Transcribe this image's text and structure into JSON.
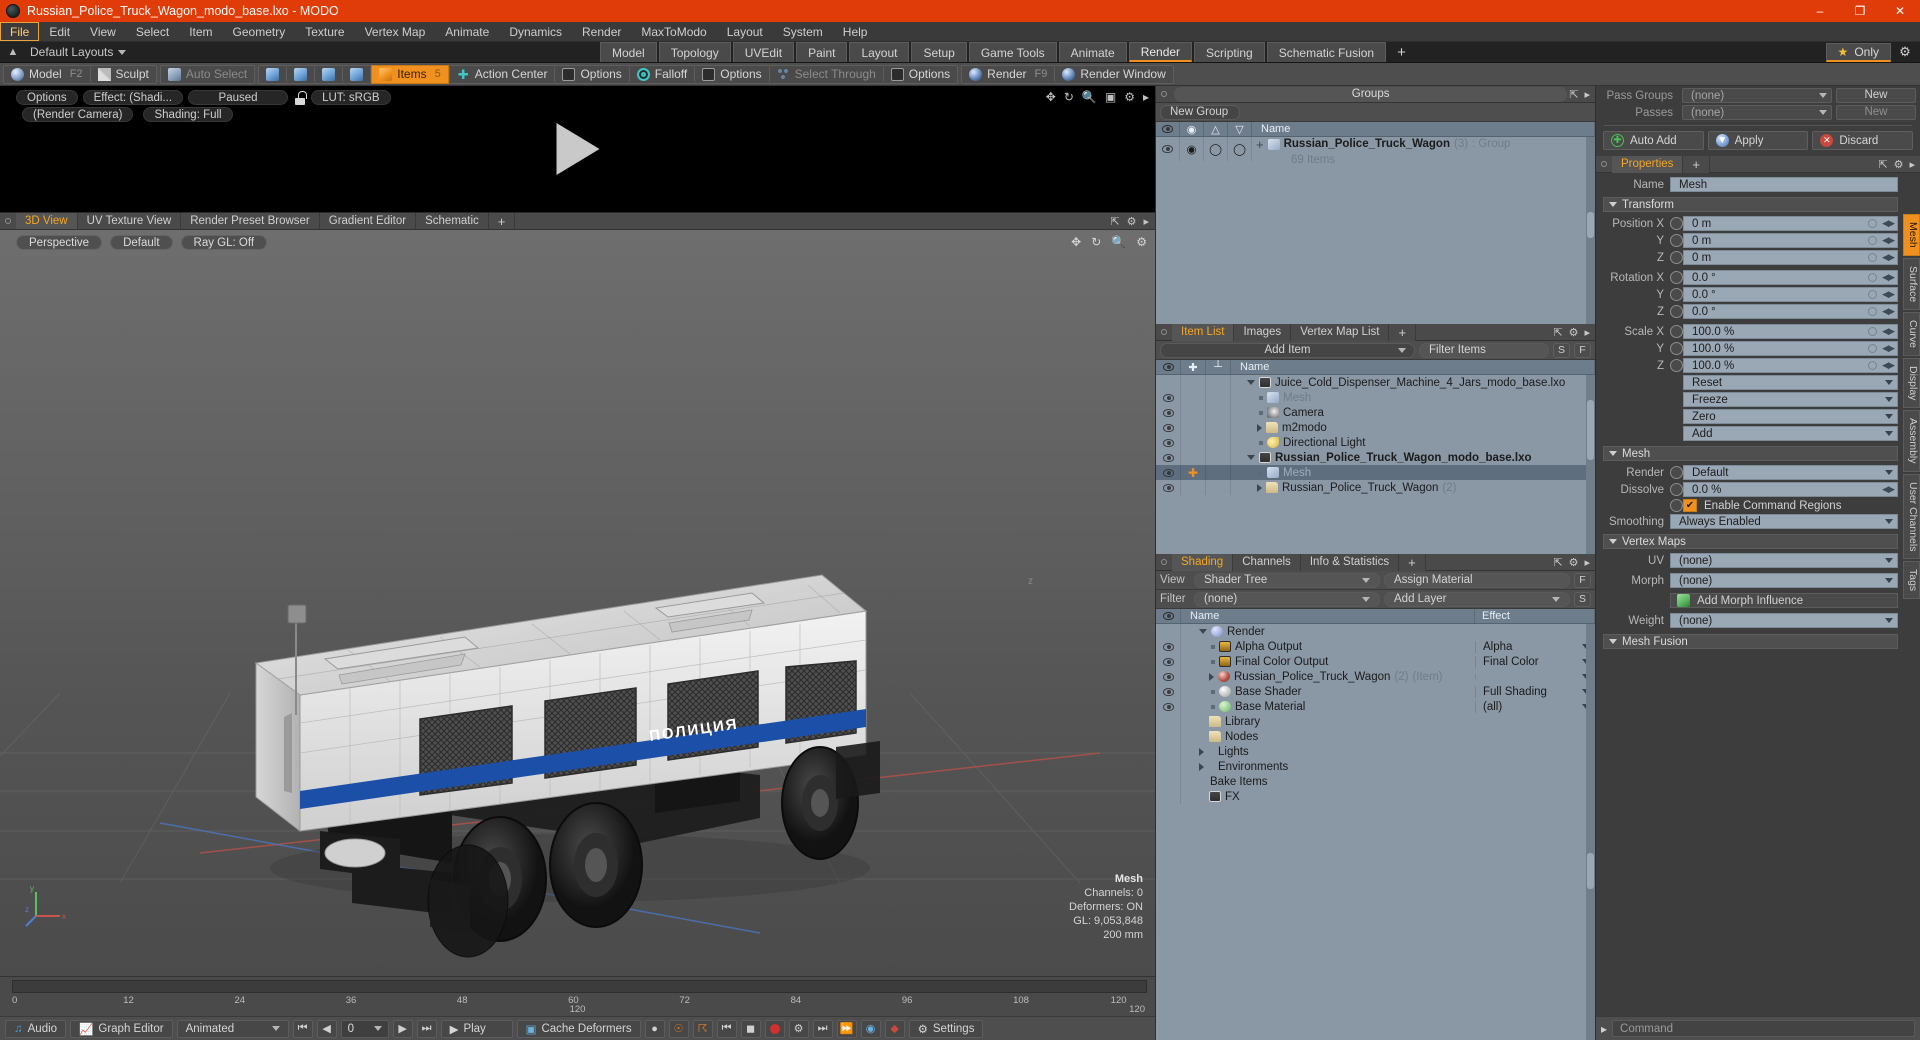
{
  "window": {
    "title": "Russian_Police_Truck_Wagon_modo_base.lxo - MODO",
    "minimize": "–",
    "maximize": "❐",
    "close": "✕"
  },
  "menu": {
    "items": [
      "File",
      "Edit",
      "View",
      "Select",
      "Item",
      "Geometry",
      "Texture",
      "Vertex Map",
      "Animate",
      "Dynamics",
      "Render",
      "MaxToModo",
      "Layout",
      "System",
      "Help"
    ],
    "active": "File"
  },
  "layoutbar": {
    "default_layouts": "Default Layouts",
    "tabs": [
      "Model",
      "Topology",
      "UVEdit",
      "Paint",
      "Layout",
      "Setup",
      "Game Tools",
      "Animate",
      "Render",
      "Scripting",
      "Schematic Fusion"
    ],
    "active_tab": "Render",
    "add_tab": "+",
    "only_label": "Only",
    "star_icon": "★",
    "gear_icon": "⚙"
  },
  "modebar": {
    "model": "Model",
    "model_hint": "F2",
    "sculpt": "Sculpt",
    "auto_select": "Auto Select",
    "items": "Items",
    "items_hint": "5",
    "action_center": "Action Center",
    "options1": "Options",
    "falloff": "Falloff",
    "options2": "Options",
    "select_through": "Select Through",
    "options3": "Options",
    "render": "Render",
    "render_hint": "F9",
    "render_window": "Render Window"
  },
  "preview": {
    "options": "Options",
    "effect": "Effect: (Shadi...",
    "paused": "Paused",
    "lut": "LUT: sRGB",
    "render_camera": "(Render Camera)",
    "shading": "Shading: Full"
  },
  "viewport": {
    "tabs": [
      "3D View",
      "UV Texture View",
      "Render Preset Browser",
      "Gradient Editor",
      "Schematic"
    ],
    "active_tab": "3D View",
    "add_tab": "+",
    "perspective": "Perspective",
    "default": "Default",
    "raygl": "Ray GL: Off",
    "axis_label": "z",
    "stats": {
      "title": "Mesh",
      "channels": "Channels: 0",
      "deformers": "Deformers: ON",
      "gl": "GL: 9,053,848",
      "scale": "200 mm"
    },
    "gizmo": {
      "x": "x",
      "y": "y",
      "z": "z"
    }
  },
  "timeline": {
    "ticks": [
      "0",
      "12",
      "24",
      "36",
      "48",
      "60",
      "72",
      "84",
      "96",
      "108",
      "120"
    ],
    "center_value": "120",
    "right_value": "120"
  },
  "bottombar": {
    "audio": "Audio",
    "graph_editor": "Graph Editor",
    "animated": "Animated",
    "frame_value": "0",
    "play": "Play",
    "cache_deformers": "Cache Deformers",
    "settings": "Settings"
  },
  "groups": {
    "title": "Groups",
    "new_group": "New Group",
    "columns": [
      "Name"
    ],
    "rows": [
      {
        "name": "Russian_Police_Truck_Wagon",
        "count": "(3)",
        "type": ": Group",
        "sub": "69 Items"
      }
    ]
  },
  "itemlist": {
    "tabs": [
      "Item List",
      "Images",
      "Vertex Map List"
    ],
    "active_tab": "Item List",
    "add_tab": "+",
    "add_item": "Add Item",
    "filter_placeholder": "Filter Items",
    "btn_s": "S",
    "btn_f": "F",
    "column_name": "Name",
    "rows": [
      {
        "label": "Juice_Cold_Dispenser_Machine_4_Jars_modo_base.lxo",
        "icon": "film-icon",
        "indent": 0,
        "toggle": "down",
        "bold": false,
        "muted": false,
        "eye": false,
        "selected": false,
        "suffix": ""
      },
      {
        "label": "Mesh",
        "icon": "mesh-icon",
        "indent": 1,
        "toggle": "dot",
        "bold": false,
        "muted": true,
        "eye": true,
        "selected": false,
        "suffix": ""
      },
      {
        "label": "Camera",
        "icon": "camera-icon",
        "indent": 1,
        "toggle": "dot",
        "bold": false,
        "muted": false,
        "eye": true,
        "selected": false,
        "suffix": ""
      },
      {
        "label": "m2modo",
        "icon": "folder-icon",
        "indent": 1,
        "toggle": "right",
        "bold": false,
        "muted": false,
        "eye": true,
        "selected": false,
        "suffix": ""
      },
      {
        "label": "Directional Light",
        "icon": "light-icon",
        "indent": 1,
        "toggle": "dot",
        "bold": false,
        "muted": false,
        "eye": true,
        "selected": false,
        "suffix": ""
      },
      {
        "label": "Russian_Police_Truck_Wagon_modo_base.lxo",
        "icon": "film-icon",
        "indent": 0,
        "toggle": "down",
        "bold": true,
        "muted": false,
        "eye": true,
        "selected": false,
        "suffix": ""
      },
      {
        "label": "Mesh",
        "icon": "mesh-icon",
        "indent": 1,
        "toggle": "dot",
        "bold": false,
        "muted": true,
        "eye": true,
        "selected": true,
        "suffix": ""
      },
      {
        "label": "Russian_Police_Truck_Wagon",
        "icon": "folder-icon",
        "indent": 1,
        "toggle": "right",
        "bold": false,
        "muted": false,
        "eye": true,
        "selected": false,
        "suffix": "(2)"
      }
    ]
  },
  "shading": {
    "tabs": [
      "Shading",
      "Channels",
      "Info & Statistics"
    ],
    "active_tab": "Shading",
    "add_tab": "+",
    "view_label": "View",
    "view_value": "Shader Tree",
    "assign_material": "Assign Material",
    "btn_f": "F",
    "filter_label": "Filter",
    "filter_value": "(none)",
    "add_layer": "Add Layer",
    "btn_s": "S",
    "column_name": "Name",
    "column_effect": "Effect",
    "rows": [
      {
        "label": "Render",
        "icon": "sphere-blue-icon",
        "indent": 0,
        "toggle": "down",
        "eye": false,
        "effect": "",
        "dropdown": false,
        "suffix": "",
        "suffix2": ""
      },
      {
        "label": "Alpha Output",
        "icon": "image-icon",
        "indent": 1,
        "toggle": "dot",
        "eye": true,
        "effect": "Alpha",
        "dropdown": true,
        "suffix": "",
        "suffix2": ""
      },
      {
        "label": "Final Color Output",
        "icon": "image-icon",
        "indent": 1,
        "toggle": "dot",
        "eye": true,
        "effect": "Final Color",
        "dropdown": true,
        "suffix": "",
        "suffix2": ""
      },
      {
        "label": "Russian_Police_Truck_Wagon",
        "icon": "sphere-red-icon",
        "indent": 1,
        "toggle": "right",
        "eye": true,
        "effect": "",
        "dropdown": true,
        "suffix": "(2)",
        "suffix2": "(Item)"
      },
      {
        "label": "Base Shader",
        "icon": "sphere-white-icon",
        "indent": 1,
        "toggle": "dot",
        "eye": true,
        "effect": "Full Shading",
        "dropdown": true,
        "suffix": "",
        "suffix2": ""
      },
      {
        "label": "Base Material",
        "icon": "sphere-green-icon",
        "indent": 1,
        "toggle": "dot",
        "eye": true,
        "effect": "(all)",
        "dropdown": true,
        "suffix": "",
        "suffix2": ""
      },
      {
        "label": "Library",
        "icon": "folder-icon",
        "indent": 1,
        "toggle": "none",
        "eye": false,
        "effect": "",
        "dropdown": false,
        "suffix": "",
        "suffix2": ""
      },
      {
        "label": "Nodes",
        "icon": "folder-icon",
        "indent": 1,
        "toggle": "none",
        "eye": false,
        "effect": "",
        "dropdown": false,
        "suffix": "",
        "suffix2": ""
      },
      {
        "label": "Lights",
        "icon": "none",
        "indent": 0,
        "toggle": "right",
        "eye": false,
        "effect": "",
        "dropdown": false,
        "suffix": "",
        "suffix2": ""
      },
      {
        "label": "Environments",
        "icon": "none",
        "indent": 0,
        "toggle": "right",
        "eye": false,
        "effect": "",
        "dropdown": false,
        "suffix": "",
        "suffix2": ""
      },
      {
        "label": "Bake Items",
        "icon": "none",
        "indent": 0,
        "toggle": "none",
        "eye": false,
        "effect": "",
        "dropdown": false,
        "suffix": "",
        "suffix2": ""
      },
      {
        "label": "FX",
        "icon": "film-icon",
        "indent": 0,
        "toggle": "none",
        "eye": false,
        "effect": "",
        "dropdown": false,
        "suffix": "",
        "suffix2": ""
      }
    ]
  },
  "properties": {
    "pass_groups_label": "Pass Groups",
    "pass_groups_value": "(none)",
    "pass_groups_new": "New",
    "passes_label": "Passes",
    "passes_value": "(none)",
    "passes_new": "New",
    "auto_add": "Auto Add",
    "apply": "Apply",
    "discard": "Discard",
    "tabs": [
      "Properties"
    ],
    "active_tab": "Properties",
    "add_tab": "+",
    "name_label": "Name",
    "name_value": "Mesh",
    "transform_header": "Transform",
    "position_x_label": "Position X",
    "position_x": "0 m",
    "position_y_label": "Y",
    "position_y": "0 m",
    "position_z_label": "Z",
    "position_z": "0 m",
    "rotation_x_label": "Rotation X",
    "rotation_x": "0.0 °",
    "rotation_y_label": "Y",
    "rotation_y": "0.0 °",
    "rotation_z_label": "Z",
    "rotation_z": "0.0 °",
    "scale_x_label": "Scale X",
    "scale_x": "100.0 %",
    "scale_y_label": "Y",
    "scale_y": "100.0 %",
    "scale_z_label": "Z",
    "scale_z": "100.0 %",
    "reset": "Reset",
    "freeze": "Freeze",
    "zero": "Zero",
    "add": "Add",
    "mesh_header": "Mesh",
    "render_label": "Render",
    "render_value": "Default",
    "dissolve_label": "Dissolve",
    "dissolve_value": "0.0 %",
    "enable_command_regions": "Enable Command Regions",
    "smoothing_label": "Smoothing",
    "smoothing_value": "Always Enabled",
    "vertex_maps_header": "Vertex Maps",
    "uv_label": "UV",
    "uv_value": "(none)",
    "morph_label": "Morph",
    "morph_value": "(none)",
    "add_morph_influence": "Add Morph Influence",
    "weight_label": "Weight",
    "weight_value": "(none)",
    "mesh_fusion_header": "Mesh Fusion",
    "side_tabs": [
      "Mesh",
      "Surface",
      "Curve",
      "Display",
      "Assembly",
      "User Channels",
      "Tags"
    ],
    "side_active": "Mesh",
    "command_placeholder": "Command"
  },
  "colors": {
    "title_bar": "#e03c0a",
    "accent": "#f0901e",
    "tab_active_text": "#f5a623",
    "panel_bg": "#3d3d3d",
    "list_bg": "#8a97a5",
    "header_bg": "#6e7d8c"
  }
}
